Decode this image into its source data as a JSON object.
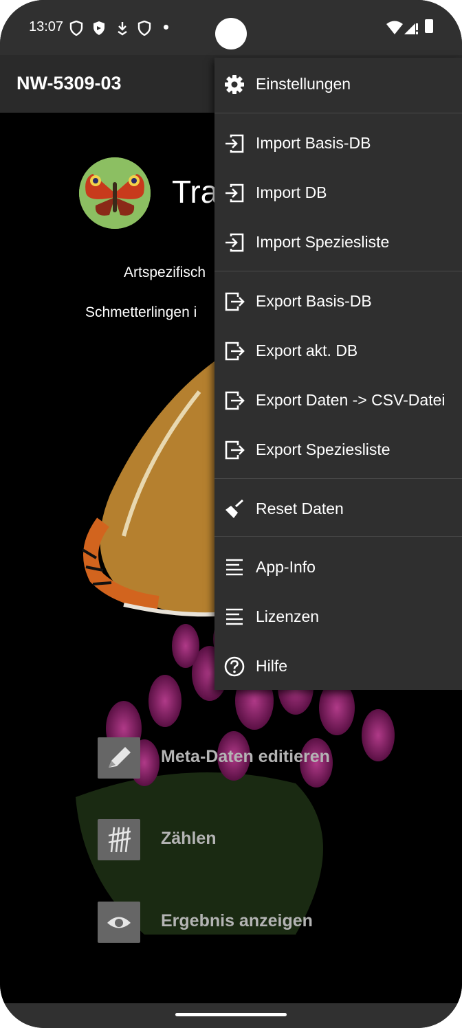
{
  "status_bar": {
    "time": "13:07"
  },
  "app_bar": {
    "title": "NW-5309-03"
  },
  "main": {
    "title": "Tra",
    "subtitle_line1": "Artspezifisch",
    "subtitle_line2": "Schmetterlingen i"
  },
  "actions": [
    {
      "label": "Meta-Daten editieren",
      "icon": "pencil-icon"
    },
    {
      "label": "Zählen",
      "icon": "tally-icon"
    },
    {
      "label": "Ergebnis anzeigen",
      "icon": "eye-icon"
    }
  ],
  "menu": {
    "items": [
      {
        "label": "Einstellungen",
        "icon": "gear-icon"
      },
      {
        "label": "Import Basis-DB",
        "icon": "import-icon"
      },
      {
        "label": "Import DB",
        "icon": "import-icon"
      },
      {
        "label": "Import Speziesliste",
        "icon": "import-icon"
      },
      {
        "label": "Export Basis-DB",
        "icon": "export-icon"
      },
      {
        "label": "Export akt. DB",
        "icon": "export-icon"
      },
      {
        "label": "Export Daten -> CSV-Datei",
        "icon": "export-icon"
      },
      {
        "label": "Export Speziesliste",
        "icon": "export-icon"
      },
      {
        "label": "Reset Daten",
        "icon": "broom-icon"
      },
      {
        "label": "App-Info",
        "icon": "text-lines-icon"
      },
      {
        "label": "Lizenzen",
        "icon": "text-lines-icon"
      },
      {
        "label": "Hilfe",
        "icon": "help-circle-icon"
      }
    ]
  },
  "colors": {
    "app_bar": "#2a2a2a",
    "menu_background": "#2f2f2f",
    "action_button": "#666666",
    "action_label": "#b4b4b4"
  }
}
